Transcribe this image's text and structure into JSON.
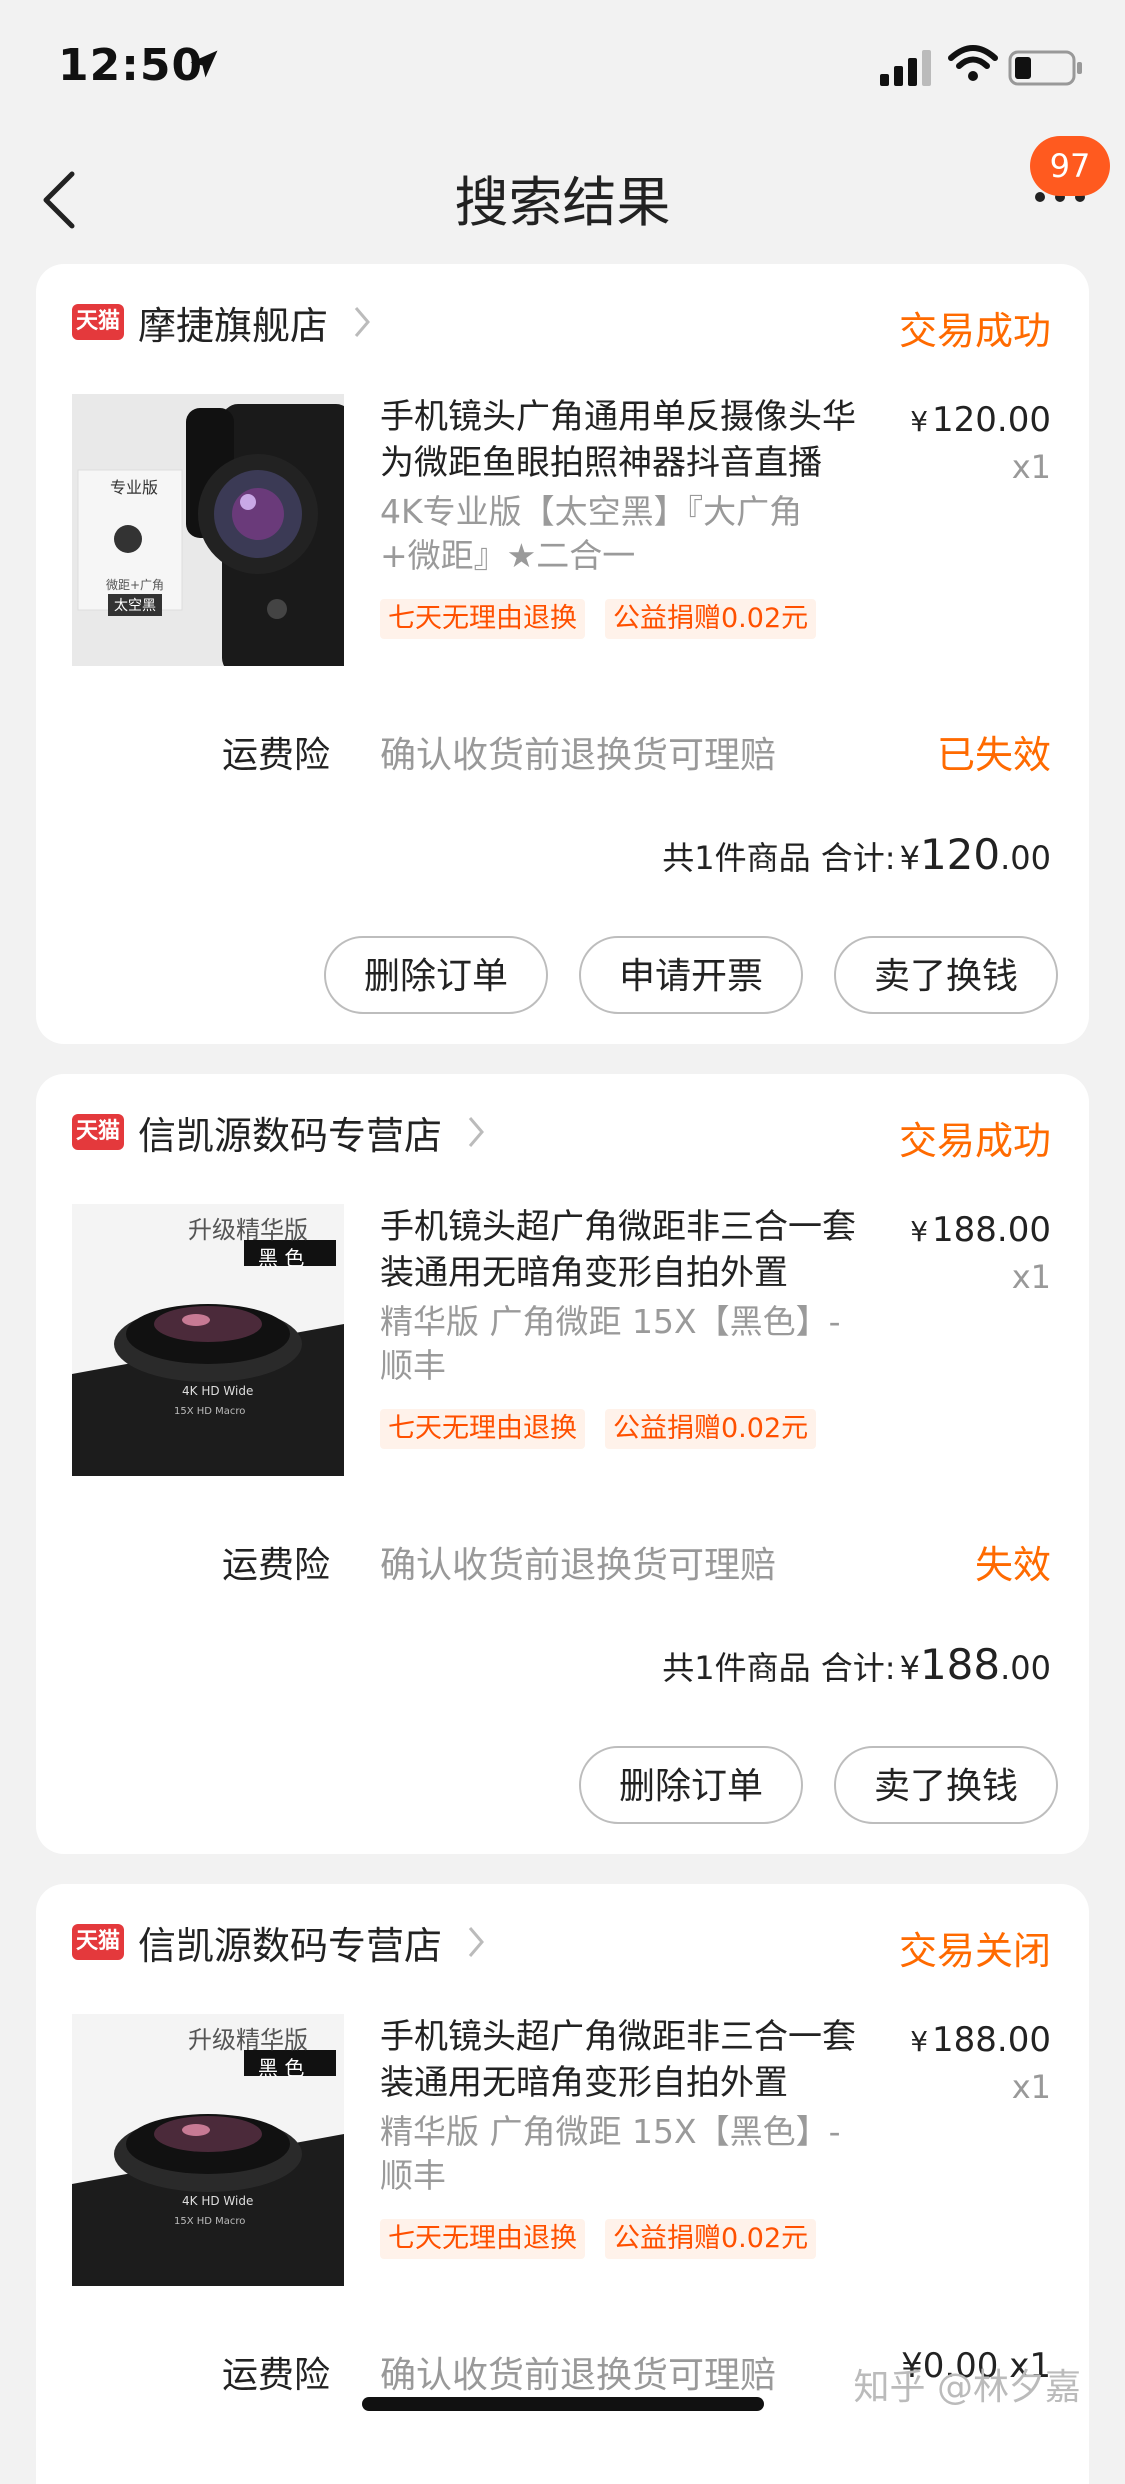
{
  "status_bar": {
    "time": "12:50"
  },
  "nav": {
    "title": "搜索结果",
    "badge": "97"
  },
  "orders": [
    {
      "shop": "摩捷旗舰店",
      "status": "交易成功",
      "title": "手机镜头广角通用单反摄像头华为微距鱼眼拍照神器抖音直播",
      "sku": "4K专业版【太空黑】『大广角+微距』★二合一",
      "tags": [
        "七天无理由退换",
        "公益捐赠0.02元"
      ],
      "price": "120.00",
      "qty": "x1",
      "insurance": {
        "label": "运费险",
        "desc": "确认收货前退换货可理赔",
        "status": "已失效"
      },
      "total": {
        "prefix": "共1件商品 合计:",
        "yen": "¥",
        "int": "120",
        "dec": ".00"
      },
      "buttons": [
        "删除订单",
        "申请开票",
        "卖了换钱"
      ],
      "thumb_text": {
        "top": "专业版",
        "mid": "微距+广角",
        "badge": "太空黑"
      }
    },
    {
      "shop": "信凯源数码专营店",
      "status": "交易成功",
      "title": "手机镜头超广角微距非三合一套装通用无暗角变形自拍外置",
      "sku": "精华版 广角微距 15X【黑色】-顺丰",
      "tags": [
        "七天无理由退换",
        "公益捐赠0.02元"
      ],
      "price": "188.00",
      "qty": "x1",
      "insurance": {
        "label": "运费险",
        "desc": "确认收货前退换货可理赔",
        "status": "失效"
      },
      "total": {
        "prefix": "共1件商品 合计:",
        "yen": "¥",
        "int": "188",
        "dec": ".00"
      },
      "buttons": [
        "删除订单",
        "卖了换钱"
      ],
      "thumb_text": {
        "top": "升级精华版",
        "badge": "黑 色",
        "lens": "4K HD Wide",
        "lens2": "15X HD Macro"
      }
    },
    {
      "shop": "信凯源数码专营店",
      "status": "交易关闭",
      "title": "手机镜头超广角微距非三合一套装通用无暗角变形自拍外置",
      "sku": "精华版 广角微距 15X【黑色】-顺丰",
      "tags": [
        "七天无理由退换",
        "公益捐赠0.02元"
      ],
      "price": "188.00",
      "qty": "x1",
      "insurance": {
        "label": "运费险",
        "desc": "确认收货前退换货可理赔",
        "status": "¥0.00 x1"
      },
      "thumb_text": {
        "top": "升级精华版",
        "badge": "黑 色",
        "lens": "4K HD Wide",
        "lens2": "15X HD Macro"
      }
    }
  ],
  "watermark": "知乎 @林夕嘉",
  "colors": {
    "accent": "#ff6a00",
    "tmall": "#e4393c",
    "background": "#f2f2f2"
  },
  "icons": {
    "tmall_label": "天猫"
  }
}
